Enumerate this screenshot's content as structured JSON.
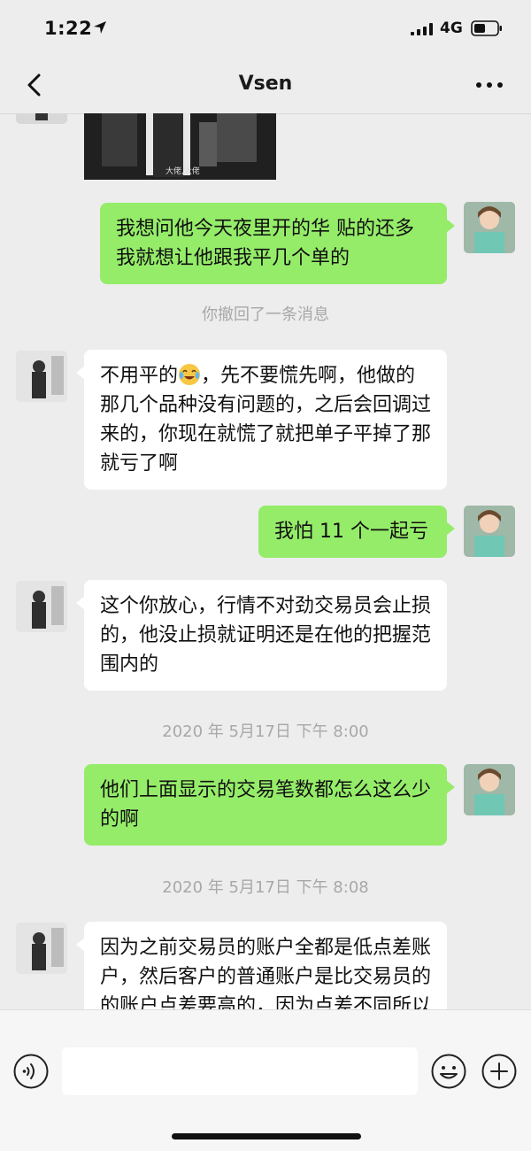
{
  "status_bar": {
    "time": "1:22",
    "network": "4G",
    "icons": [
      "location-arrow-icon",
      "signal-icon",
      "battery-icon"
    ]
  },
  "nav": {
    "title": "Vsen",
    "icons": [
      "back-chevron-icon",
      "more-dots-icon"
    ]
  },
  "image_message": {
    "caption": "大佬,大佬"
  },
  "messages": [
    {
      "side": "out",
      "text": "我想问他今天夜里开的华 贴的还多 我就想让他跟我平几个单的"
    },
    {
      "side": "system",
      "text": "你撤回了一条消息"
    },
    {
      "side": "in",
      "text_before_emoji": "不用平的",
      "emoji": "crying-laughing-emoji",
      "text_after_emoji": "，先不要慌先啊，他做的那几个品种没有问题的，之后会回调过来的，你现在就慌了就把单子平掉了那就亏了啊"
    },
    {
      "side": "out",
      "text": "我怕 11 个一起亏"
    },
    {
      "side": "in",
      "text": "这个你放心，行情不对劲交易员会止损的，他没止损就证明还是在他的把握范围内的"
    },
    {
      "side": "system",
      "text": "2020 年 5月17日 下午 8:00"
    },
    {
      "side": "out",
      "text": "他们上面显示的交易笔数都怎么这么少的啊"
    },
    {
      "side": "system",
      "text": "2020 年 5月17日 下午 8:08"
    },
    {
      "side": "in",
      "text": "因为之前交易员的账户全都是低点差账户，然后客户的普通账户是比交易员的的账户点差要高的，因为点差不同所以之前偶尔会有交易员"
    }
  ],
  "input_bar": {
    "text_value": "",
    "icons": [
      "voice-icon",
      "emoji-icon",
      "plus-icon"
    ]
  },
  "colors": {
    "background": "#ededed",
    "outgoing_bubble": "#95ec69",
    "incoming_bubble": "#ffffff",
    "system_text": "#a8a8a8"
  }
}
